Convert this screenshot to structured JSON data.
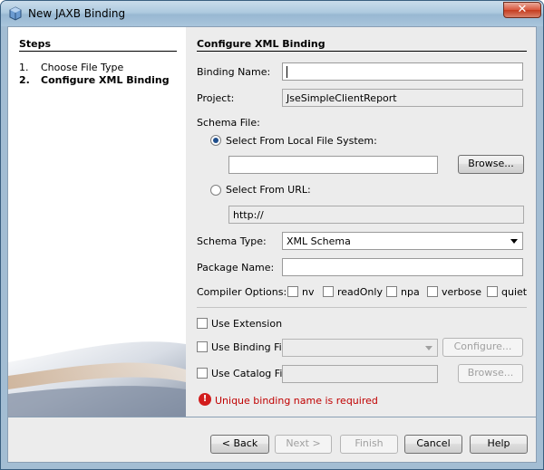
{
  "window": {
    "title": "New JAXB Binding",
    "close_glyph": "✕"
  },
  "steps": {
    "heading": "Steps",
    "items": [
      {
        "num": "1.",
        "label": "Choose File Type"
      },
      {
        "num": "2.",
        "label": "Configure XML Binding"
      }
    ]
  },
  "form": {
    "heading": "Configure XML Binding",
    "binding_name_label": "Binding Name:",
    "binding_name_value": "",
    "project_label": "Project:",
    "project_value": "JseSimpleClientReport",
    "schema_file_label": "Schema File:",
    "local_fs_label": "Select From Local File System:",
    "local_fs_value": "",
    "browse_label": "Browse...",
    "url_label": "Select From URL:",
    "url_value": "http://",
    "schema_type_label": "Schema Type:",
    "schema_type_value": "XML Schema",
    "package_name_label": "Package Name:",
    "package_name_value": "",
    "compiler_options_label": "Compiler Options:",
    "compiler_options": [
      "nv",
      "readOnly",
      "npa",
      "verbose",
      "quiet"
    ],
    "use_extension_label": "Use Extension",
    "use_binding_file_label": "Use Binding File",
    "configure_label": "Configure...",
    "use_catalog_file_label": "Use Catalog File",
    "browse_catalog_label": "Browse...",
    "error_glyph": "!",
    "error_message": "Unique binding name is required"
  },
  "footer": {
    "back": "< Back",
    "next": "Next >",
    "finish": "Finish",
    "cancel": "Cancel",
    "help": "Help"
  }
}
